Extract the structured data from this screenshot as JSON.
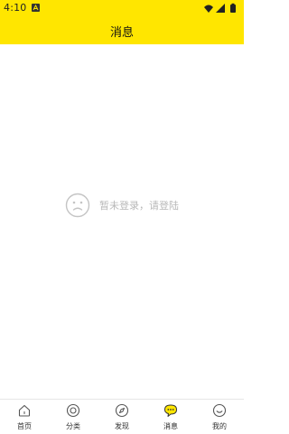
{
  "status_bar": {
    "time": "4:10"
  },
  "header": {
    "title": "消息"
  },
  "empty_state": {
    "message": "暂未登录，请登陆"
  },
  "tabbar": {
    "items": [
      {
        "label": "首页",
        "icon": "home-icon"
      },
      {
        "label": "分类",
        "icon": "category-icon"
      },
      {
        "label": "发现",
        "icon": "compass-icon"
      },
      {
        "label": "消息",
        "icon": "message-icon",
        "active": true
      },
      {
        "label": "我的",
        "icon": "profile-icon"
      }
    ],
    "active_color": "#ffe600"
  },
  "colors": {
    "header_bg": "#ffe600"
  }
}
